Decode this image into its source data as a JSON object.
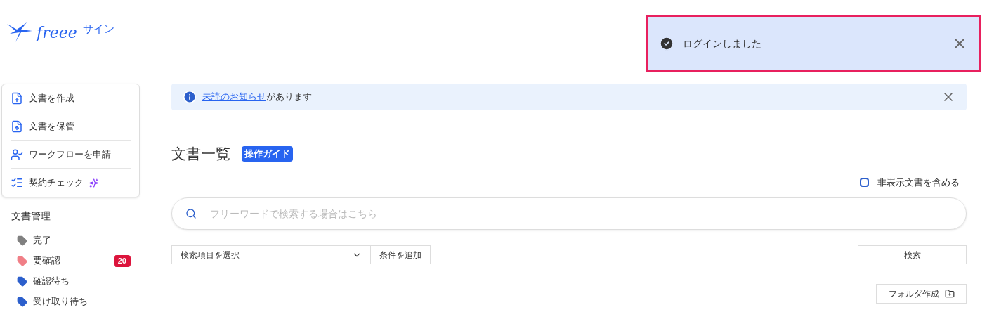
{
  "logo": {
    "text": "freee",
    "suffix": "サイン"
  },
  "toast": {
    "message": "ログインしました"
  },
  "actions": [
    {
      "kind": "create",
      "label": "文書を作成",
      "sparkle": false
    },
    {
      "kind": "upload",
      "label": "文書を保管",
      "sparkle": false
    },
    {
      "kind": "workflow",
      "label": "ワークフローを申請",
      "sparkle": false
    },
    {
      "kind": "check",
      "label": "契約チェック",
      "sparkle": true
    }
  ],
  "sidebar": {
    "heading": "文書管理",
    "items": [
      {
        "label": "完了",
        "color": "#808080"
      },
      {
        "label": "要確認",
        "color": "#f07f87",
        "badge": "20"
      },
      {
        "label": "確認待ち",
        "color": "#2c5fcc"
      },
      {
        "label": "受け取り待ち",
        "color": "#2c5fcc"
      }
    ]
  },
  "notice": {
    "link": "未読のお知らせ",
    "text": "があります"
  },
  "page": {
    "title": "文書一覧",
    "guide": "操作ガイド"
  },
  "hidden_docs": {
    "label": "非表示文書を含める",
    "checked": false
  },
  "search": {
    "placeholder": "フリーワードで検索する場合はこちら"
  },
  "filter": {
    "select": "検索項目を選択",
    "add": "条件を追加",
    "search": "検索"
  },
  "folder_button": "フォルダ作成"
}
